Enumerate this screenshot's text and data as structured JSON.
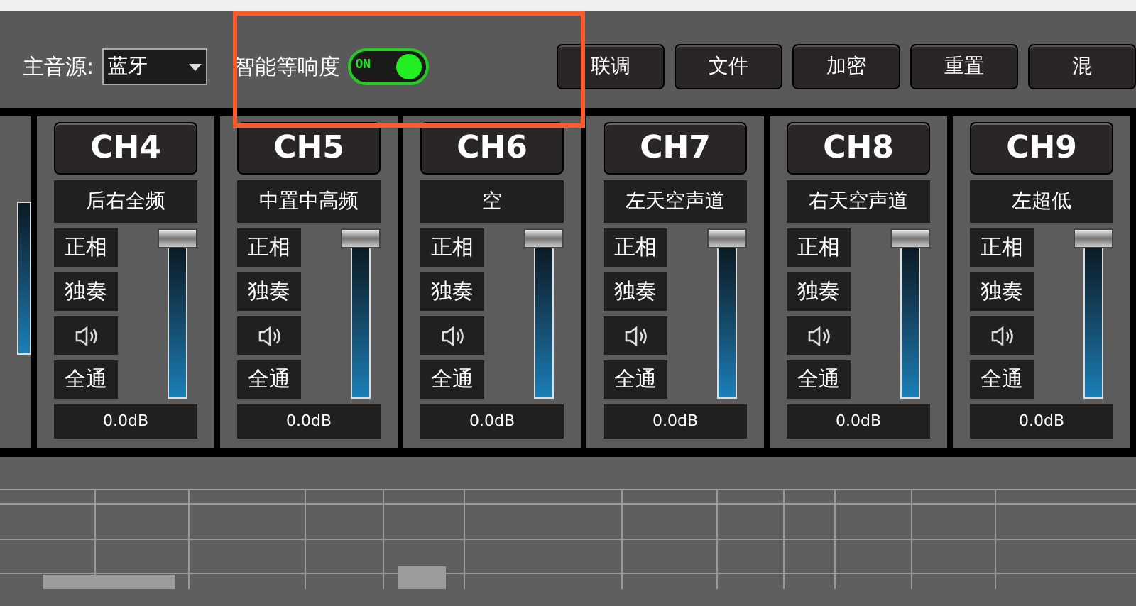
{
  "toolbar": {
    "source_label": "主音源:",
    "source_dropdown": {
      "value": "蓝牙"
    },
    "loudness": {
      "label": "智能等响度",
      "toggle": {
        "on": true,
        "text": "ON"
      }
    },
    "buttons": [
      "联调",
      "文件",
      "加密",
      "重置",
      "混"
    ]
  },
  "channels": [
    {
      "title": "CH4",
      "name": "后右全频",
      "buttons": [
        "正相",
        "独奏",
        "全通"
      ],
      "fader": {
        "level": 1
      },
      "reading": "0.0dB"
    },
    {
      "title": "CH5",
      "name": "中置中高频",
      "buttons": [
        "正相",
        "独奏",
        "全通"
      ],
      "fader": {
        "level": 1
      },
      "reading": "0.0dB"
    },
    {
      "title": "CH6",
      "name": "空",
      "buttons": [
        "正相",
        "独奏",
        "全通"
      ],
      "fader": {
        "level": 1
      },
      "reading": "0.0dB"
    },
    {
      "title": "CH7",
      "name": "左天空声道",
      "buttons": [
        "正相",
        "独奏",
        "全通"
      ],
      "fader": {
        "level": 1
      },
      "reading": "0.0dB"
    },
    {
      "title": "CH8",
      "name": "右天空声道",
      "buttons": [
        "正相",
        "独奏",
        "全通"
      ],
      "fader": {
        "level": 1
      },
      "reading": "0.0dB"
    },
    {
      "title": "CH9",
      "name": "左超低",
      "buttons": [
        "正相",
        "独奏",
        "全通"
      ],
      "fader": {
        "level": 1
      },
      "reading": "0.0dB"
    }
  ]
}
